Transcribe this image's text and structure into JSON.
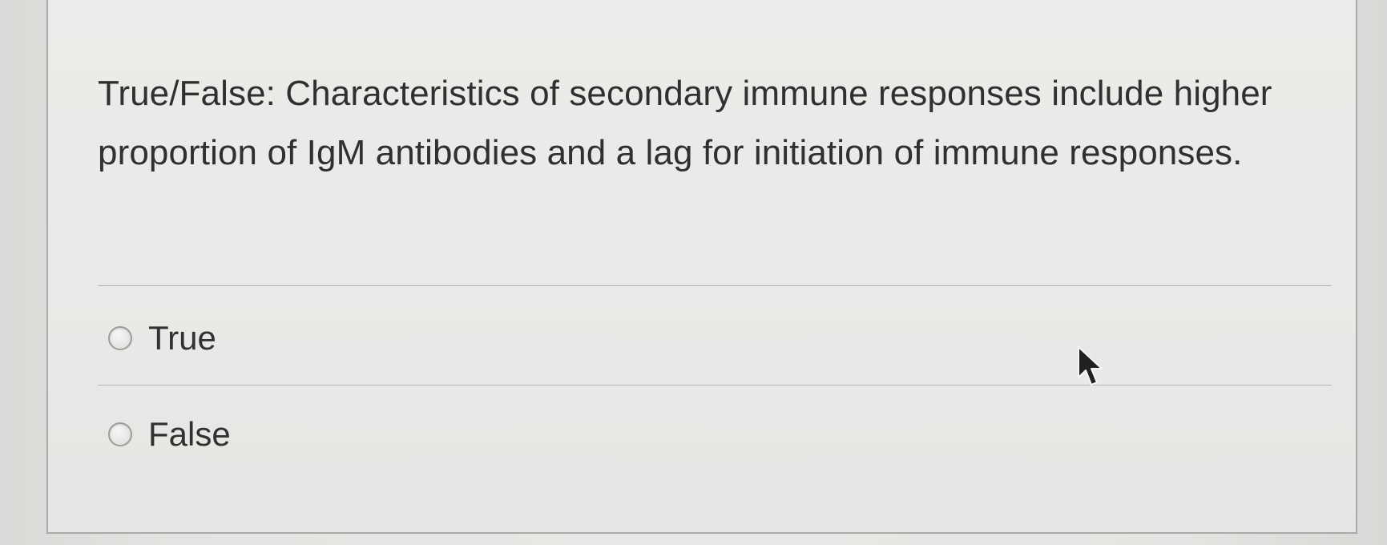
{
  "question": {
    "text": "True/False: Characteristics of secondary immune responses include higher proportion of IgM antibodies and a lag for initiation of immune responses.",
    "options": [
      {
        "label": "True",
        "selected": false
      },
      {
        "label": "False",
        "selected": false
      }
    ]
  },
  "icons": {
    "option_icon": "radio-button-unchecked-icon",
    "pointer": "mouse-pointer-icon"
  },
  "colors": {
    "text": "#2f3030",
    "divider": "#b4b5b2",
    "card_border": "#a9aaa7"
  }
}
